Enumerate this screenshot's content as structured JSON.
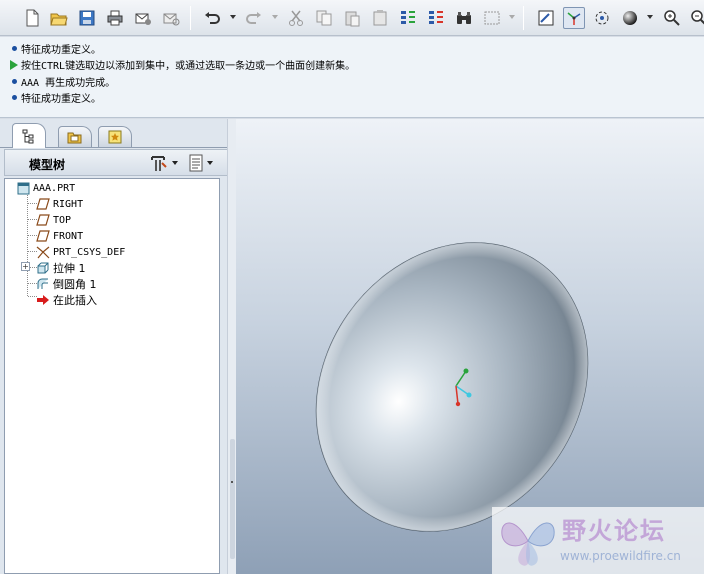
{
  "messages": [
    {
      "icon": "bullet",
      "text": "特征成功重定义。"
    },
    {
      "icon": "green-arrow",
      "text": "按住CTRL键选取边以添加到集中，或通过选取一条边或一个曲面创建新集。"
    },
    {
      "icon": "bullet",
      "text": "AAA 再生成功完成。"
    },
    {
      "icon": "bullet",
      "text": "特征成功重定义。"
    }
  ],
  "model_tree": {
    "title": "模型树",
    "items": [
      {
        "label": "AAA.PRT",
        "icon": "part-icon"
      },
      {
        "label": "RIGHT",
        "icon": "datum-plane-icon"
      },
      {
        "label": "TOP",
        "icon": "datum-plane-icon"
      },
      {
        "label": "FRONT",
        "icon": "datum-plane-icon"
      },
      {
        "label": "PRT_CSYS_DEF",
        "icon": "csys-icon"
      },
      {
        "label": "拉伸 1",
        "icon": "extrude-icon"
      },
      {
        "label": "倒圆角 1",
        "icon": "round-icon"
      },
      {
        "label": "在此插入",
        "icon": "insert-here-arrow-icon"
      }
    ]
  },
  "watermark": {
    "title": "野火论坛",
    "url": "www.proewildfire.cn"
  },
  "colors": {
    "accent": "#1b4fa0",
    "viewport_top": "#eef2f7",
    "viewport_bottom": "#8ea0b6",
    "insert_arrow": "#d81c1c"
  }
}
